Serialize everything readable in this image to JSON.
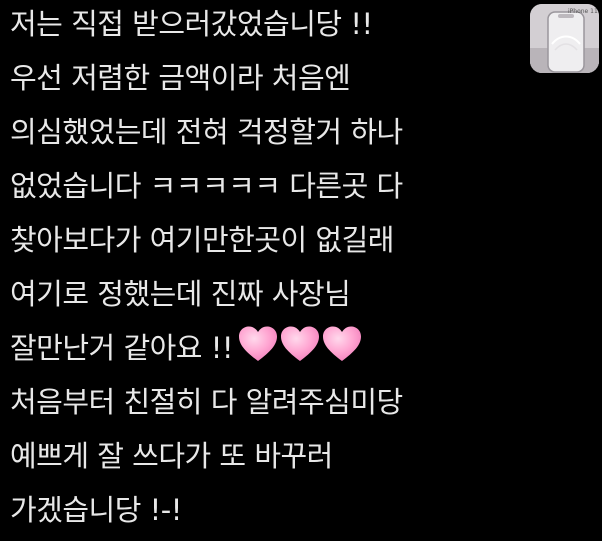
{
  "message": {
    "lines": [
      "저는 직접 받으러갔었습니당 !!",
      "우선 저렴한 금액이라 처음엔",
      "의심했었는데 전혀 걱정할거 하나",
      "없었습니다 ㅋㅋㅋㅋㅋ 다른곳 다",
      "찾아보다가 여기만한곳이 없길래",
      "여기로 정했는데 진짜 사장님",
      "잘만난거 같아요 !!",
      "처음부터 친절히 다 알려주심미당",
      "예쁘게 잘 쓰다가 또 바꾸러",
      "가겠습니당 !-!"
    ],
    "hearts_count": 3
  },
  "thumbnail": {
    "label": "iPhone 11"
  },
  "colors": {
    "background": "#000000",
    "text": "#e8e8e8",
    "heart": "#ff9fcf"
  }
}
